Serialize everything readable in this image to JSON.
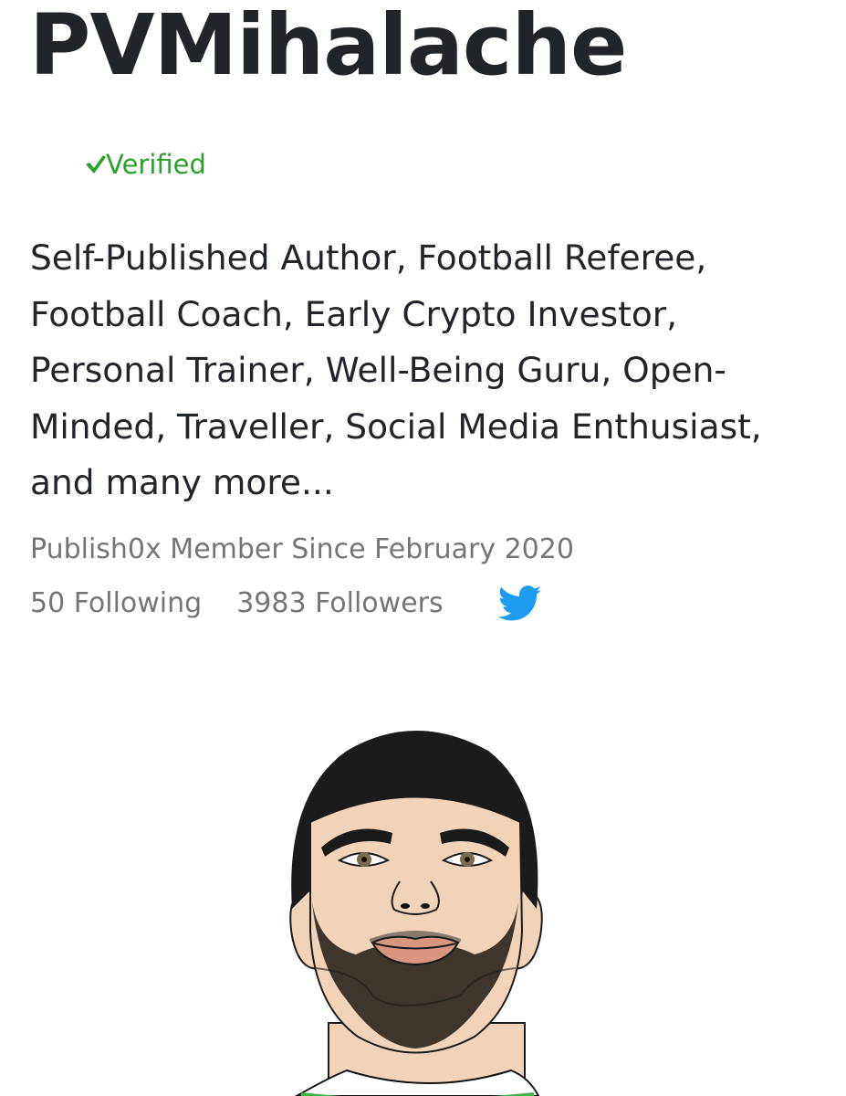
{
  "profile": {
    "username": "PVMihalache",
    "verified_label": "Verified",
    "bio": "Self-Published Author, Football Referee, Football Coach, Early Crypto Investor, Personal Trainer, Well-Being Guru, Open-Minded, Traveller, Social Media Enthusiast, and many more...",
    "member_since": "Publish0x Member Since February 2020",
    "following": "50 Following",
    "followers": "3983 Followers"
  },
  "icons": {
    "verified": "checkmark-icon",
    "social": "twitter-icon",
    "avatar": "cartoon-portrait-avatar"
  },
  "colors": {
    "title": "#212529",
    "text": "#212529",
    "muted": "#757575",
    "verified": "#2aa12a",
    "twitter": "#1d9bf0",
    "background": "#ffffff"
  }
}
